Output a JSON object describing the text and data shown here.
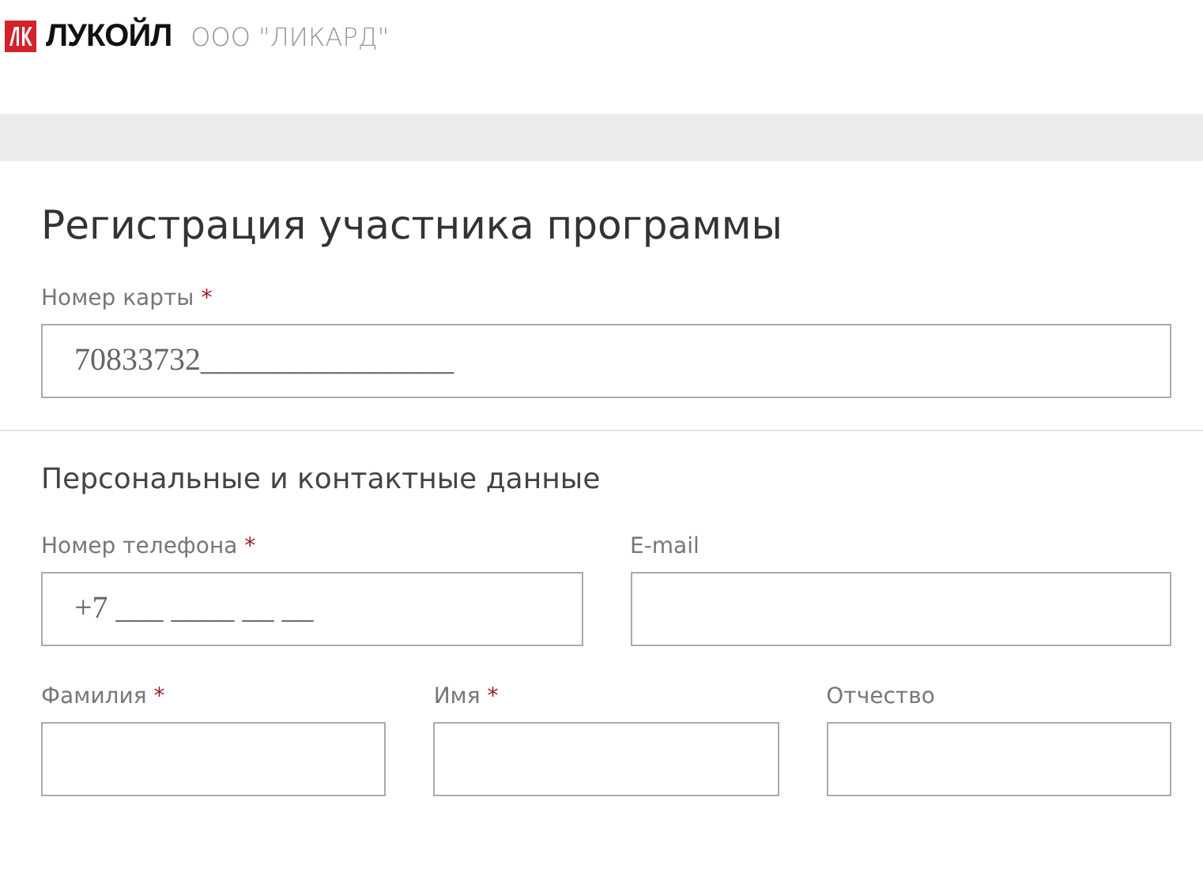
{
  "header": {
    "brand": "ЛУКОЙЛ",
    "company": "ООО \"ЛИКАРД\""
  },
  "title": "Регистрация участника программы",
  "card_field": {
    "label": "Номер карты",
    "required_mark": "*",
    "value": "70833732________________"
  },
  "section": {
    "title": "Персональные и контактные данные",
    "rows": [
      [
        {
          "label": "Номер телефона",
          "required_mark": "*",
          "value": "+7 ___ ____ __ __"
        },
        {
          "label": "E-mail"
        }
      ],
      [
        {
          "label": "Фамилия",
          "required_mark": "*"
        },
        {
          "label": "Имя",
          "required_mark": "*"
        },
        {
          "label": "Отчество"
        }
      ]
    ]
  }
}
